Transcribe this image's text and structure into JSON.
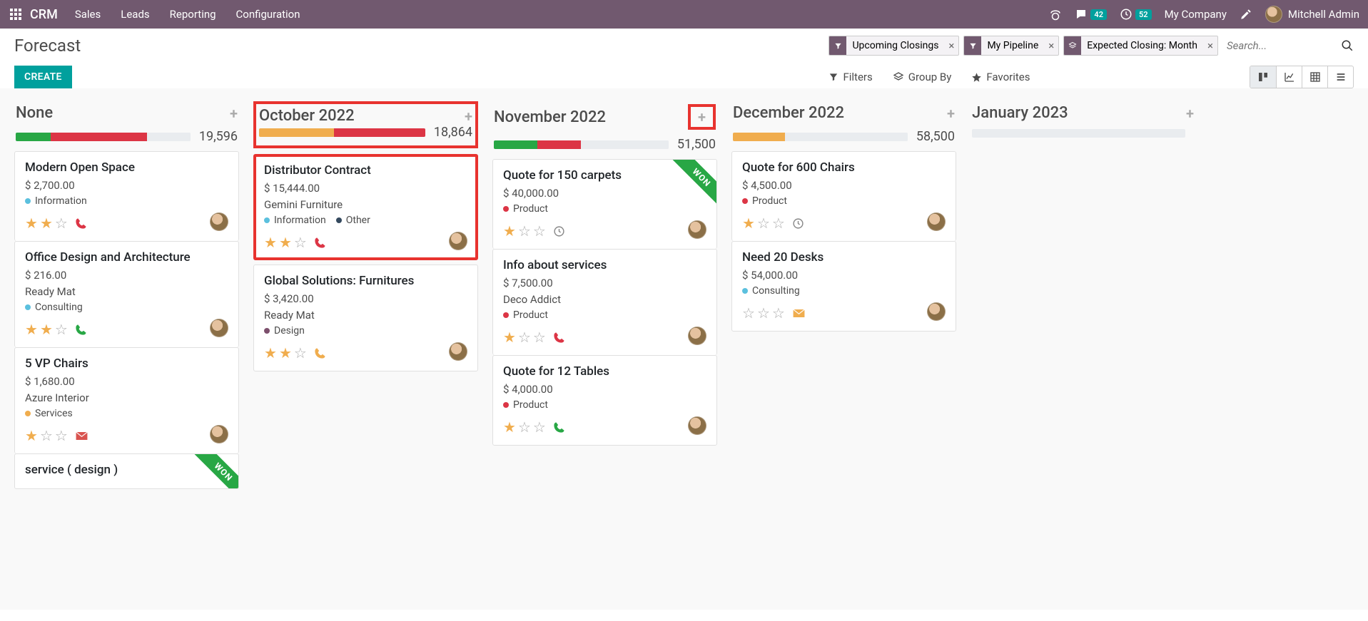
{
  "nav": {
    "brand": "CRM",
    "items": [
      "Sales",
      "Leads",
      "Reporting",
      "Configuration"
    ],
    "messages_badge": "42",
    "activities_badge": "52",
    "company": "My Company",
    "user": "Mitchell Admin"
  },
  "header": {
    "title": "Forecast",
    "create_label": "CREATE",
    "search_placeholder": "Search...",
    "facets": [
      {
        "icon": "filter",
        "label": "Upcoming Closings"
      },
      {
        "icon": "filter",
        "label": "My Pipeline"
      },
      {
        "icon": "group",
        "label": "Expected Closing: Month"
      }
    ],
    "filters_label": "Filters",
    "groupby_label": "Group By",
    "favorites_label": "Favorites"
  },
  "colors": {
    "green": "#28a745",
    "red": "#dc3545",
    "orange": "#f0ad4e",
    "gray": "#e9ecef",
    "info_blue": "#5bc0de",
    "navy": "#34495e",
    "purple": "#7c4f6c"
  },
  "columns": [
    {
      "title": "None",
      "total": "19,596",
      "highlight_header": false,
      "highlight_add": false,
      "segments": [
        {
          "color": "green",
          "pct": 20
        },
        {
          "color": "red",
          "pct": 55
        },
        {
          "color": "gray",
          "pct": 25
        }
      ],
      "cards": [
        {
          "title": "Modern Open Space",
          "amount": "$ 2,700.00",
          "tags": [
            {
              "color": "info_blue",
              "label": "Information"
            }
          ],
          "stars": 2,
          "icon": "phone",
          "icon_color": "#dc3545",
          "avatar": true
        },
        {
          "title": "Office Design and Architecture",
          "amount": "$ 216.00",
          "sub": "Ready Mat",
          "tags": [
            {
              "color": "info_blue",
              "label": "Consulting"
            }
          ],
          "stars": 2,
          "icon": "phone",
          "icon_color": "#28a745",
          "avatar": true
        },
        {
          "title": "5 VP Chairs",
          "amount": "$ 1,680.00",
          "sub": "Azure Interior",
          "tags": [
            {
              "color": "orange",
              "label": "Services"
            }
          ],
          "stars": 1,
          "icon": "mail",
          "icon_color": "#d9534f",
          "avatar": true
        },
        {
          "title": "service ( design )",
          "won": true
        }
      ]
    },
    {
      "title": "October 2022",
      "total": "18,864",
      "highlight_header": true,
      "highlight_add": false,
      "segments": [
        {
          "color": "orange",
          "pct": 45
        },
        {
          "color": "red",
          "pct": 55
        }
      ],
      "cards": [
        {
          "title": "Distributor Contract",
          "amount": "$ 15,444.00",
          "sub": "Gemini Furniture",
          "tags": [
            {
              "color": "info_blue",
              "label": "Information"
            },
            {
              "color": "navy",
              "label": "Other"
            }
          ],
          "stars": 2,
          "icon": "phone",
          "icon_color": "#dc3545",
          "avatar": true,
          "highlight": true
        },
        {
          "title": "Global Solutions: Furnitures",
          "amount": "$ 3,420.00",
          "sub": "Ready Mat",
          "tags": [
            {
              "color": "purple",
              "label": "Design"
            }
          ],
          "stars": 2,
          "icon": "phone",
          "icon_color": "#f0ad4e",
          "avatar": true
        }
      ]
    },
    {
      "title": "November 2022",
      "total": "51,500",
      "highlight_header": false,
      "highlight_add": true,
      "segments": [
        {
          "color": "green",
          "pct": 25
        },
        {
          "color": "red",
          "pct": 25
        },
        {
          "color": "gray",
          "pct": 50
        }
      ],
      "cards": [
        {
          "title": "Quote for 150 carpets",
          "amount": "$ 40,000.00",
          "tags": [
            {
              "color": "red",
              "label": "Product"
            }
          ],
          "stars": 1,
          "icon": "clock",
          "icon_color": "#888",
          "avatar": true,
          "won": true
        },
        {
          "title": "Info about services",
          "amount": "$ 7,500.00",
          "sub": "Deco Addict",
          "tags": [
            {
              "color": "red",
              "label": "Product"
            }
          ],
          "stars": 1,
          "icon": "phone",
          "icon_color": "#dc3545",
          "avatar": true
        },
        {
          "title": "Quote for 12 Tables",
          "amount": "$ 4,000.00",
          "tags": [
            {
              "color": "red",
              "label": "Product"
            }
          ],
          "stars": 1,
          "icon": "phone",
          "icon_color": "#28a745",
          "avatar": true
        }
      ]
    },
    {
      "title": "December 2022",
      "total": "58,500",
      "highlight_header": false,
      "highlight_add": false,
      "segments": [
        {
          "color": "orange",
          "pct": 30
        },
        {
          "color": "gray",
          "pct": 70
        }
      ],
      "cards": [
        {
          "title": "Quote for 600 Chairs",
          "amount": "$ 4,500.00",
          "tags": [
            {
              "color": "red",
              "label": "Product"
            }
          ],
          "stars": 1,
          "icon": "clock",
          "icon_color": "#888",
          "avatar": true
        },
        {
          "title": "Need 20 Desks",
          "amount": "$ 54,000.00",
          "tags": [
            {
              "color": "info_blue",
              "label": "Consulting"
            }
          ],
          "stars": 0,
          "icon": "mail",
          "icon_color": "#f0ad4e",
          "avatar": true
        }
      ]
    },
    {
      "title": "January 2023",
      "total": "",
      "highlight_header": false,
      "highlight_add": false,
      "segments": [
        {
          "color": "gray",
          "pct": 100
        }
      ],
      "cards": []
    }
  ]
}
